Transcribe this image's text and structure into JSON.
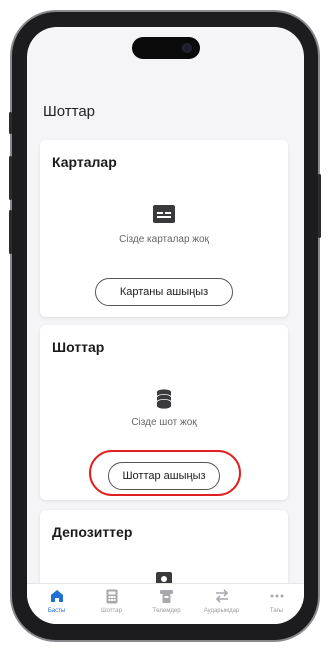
{
  "page": {
    "title": "Шоттар"
  },
  "cards": [
    {
      "title": "Карталар",
      "icon": "card-icon",
      "message": "Сізде карталар жоқ",
      "button": "Картаны ашыңыз"
    },
    {
      "title": "Шоттар",
      "icon": "coins-stack-icon",
      "message": "Сізде шот жоқ",
      "button": "Шоттар ашыңыз"
    },
    {
      "title": "Депозиттер",
      "icon": "deposit-icon"
    }
  ],
  "tabs": [
    {
      "label": "Басты",
      "icon": "home-icon",
      "active": true
    },
    {
      "label": "Шоттар",
      "icon": "calculator-icon",
      "active": false
    },
    {
      "label": "Төлемдер",
      "icon": "payment-terminal-icon",
      "active": false
    },
    {
      "label": "Аударымдар",
      "icon": "transfer-arrows-icon",
      "active": false
    },
    {
      "label": "Тағы",
      "icon": "more-dots-icon",
      "active": false
    }
  ],
  "colors": {
    "accent": "#1f6fd6",
    "highlight": "#e02020",
    "screen_bg": "#f5f5f7",
    "icon_dark": "#3a3a3c"
  }
}
